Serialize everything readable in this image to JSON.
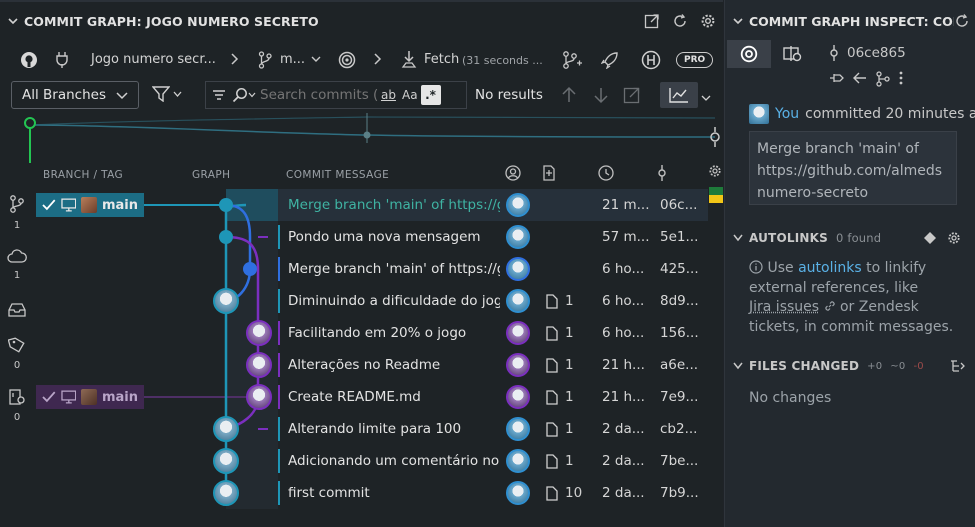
{
  "graph_panel": {
    "title": "COMMIT GRAPH: JOGO NUMERO SECRETO",
    "repo_name": "Jogo numero secr...",
    "branch_short": "m...",
    "fetch_label": "Fetch",
    "fetch_time": "(31 seconds ...",
    "pro_label": "PRO",
    "branch_filter": "All Branches",
    "search_placeholder": "Search commits (1",
    "search_opt_word": "ab",
    "search_opt_case": "Aa",
    "search_opt_regex": ".*",
    "search_results": "No results",
    "columns": {
      "branch_tag": "BRANCH / TAG",
      "graph": "GRAPH",
      "message": "COMMIT MESSAGE"
    },
    "activity_counts": [
      "1",
      "1",
      "0",
      "0"
    ],
    "tags": [
      {
        "name": "main",
        "kind": "local-selected"
      },
      {
        "name": "main",
        "kind": "remote"
      }
    ],
    "commits": [
      {
        "message": "Merge branch 'main' of https://gith",
        "files": "",
        "time": "21 m...",
        "sha": "06c..."
      },
      {
        "message": "Pondo uma nova mensagem",
        "files": "",
        "time": "57 m...",
        "sha": "5e1..."
      },
      {
        "message": "Merge branch 'main' of https://gith",
        "files": "",
        "time": "6 ho...",
        "sha": "425..."
      },
      {
        "message": "Diminuindo a dificuldade do jogo e",
        "files": "1",
        "time": "6 ho...",
        "sha": "8d9..."
      },
      {
        "message": "Facilitando em 20% o jogo",
        "files": "1",
        "time": "6 ho...",
        "sha": "156..."
      },
      {
        "message": "Alterações no Readme",
        "files": "1",
        "time": "21 h...",
        "sha": "a6e..."
      },
      {
        "message": "Create README.md",
        "files": "1",
        "time": "21 h...",
        "sha": "7e9..."
      },
      {
        "message": "Alterando limite para 100",
        "files": "1",
        "time": "2 da...",
        "sha": "cb2..."
      },
      {
        "message": "Adicionando um comentário no fina",
        "files": "1",
        "time": "2 da...",
        "sha": "7be..."
      },
      {
        "message": "first commit",
        "files": "10",
        "time": "2 da...",
        "sha": "7b9..."
      }
    ]
  },
  "inspect_panel": {
    "title": "COMMIT GRAPH INSPECT: COM...",
    "sha": "06ce865",
    "committer_you": "You",
    "committer_rest": "committed 20 minutes ag",
    "message_lines": [
      "Merge branch 'main' of",
      "https://github.com/almeds",
      "numero-secreto"
    ],
    "autolinks_title": "AUTOLINKS",
    "autolinks_count": "0 found",
    "autolinks_text_1": "Use",
    "autolinks_link": "autolinks",
    "autolinks_text_2": "to linkify",
    "autolinks_text_3": "external references, like",
    "autolinks_jira": "Jira issues",
    "autolinks_text_4": "or Zendesk",
    "autolinks_text_5": "tickets, in commit messages.",
    "files_title": "FILES CHANGED",
    "files_plus": "+0",
    "files_tilde": "~0",
    "files_minus": "-0",
    "files_empty": "No changes"
  },
  "colors": {
    "lane_teal": "#1e96b7",
    "lane_blue": "#2f6fe0",
    "lane_purple": "#7b2fbf",
    "lane_green": "#23c552",
    "accent_link": "#5ab1e6"
  }
}
